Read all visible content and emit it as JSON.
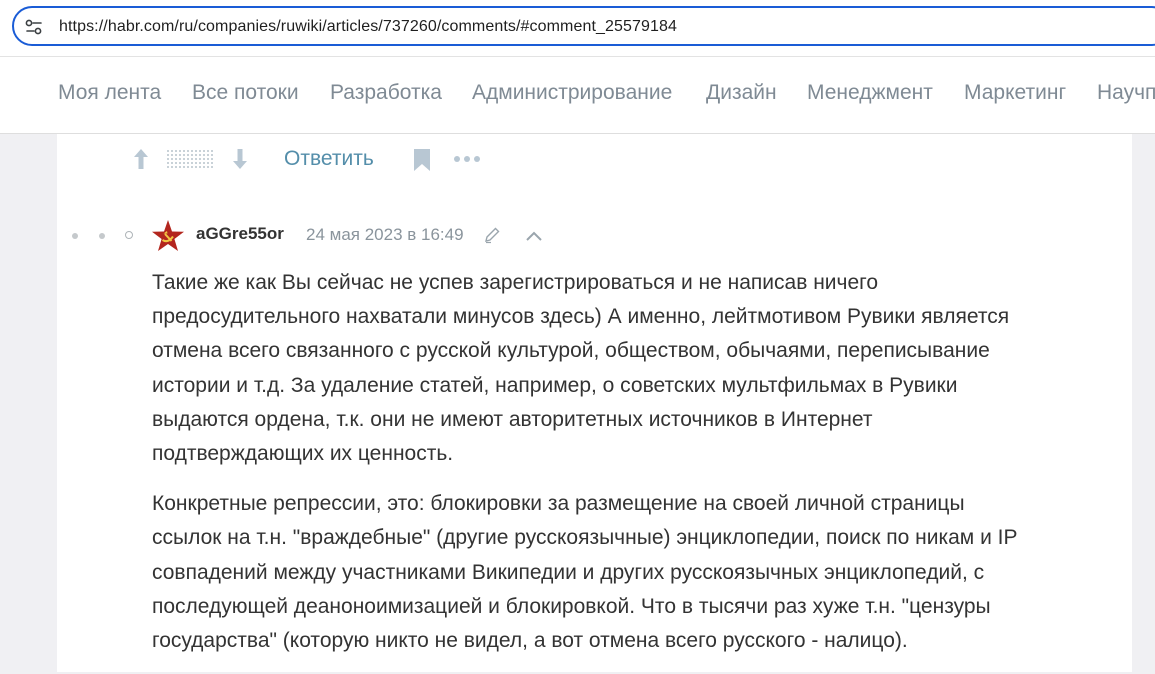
{
  "browser": {
    "url": "https://habr.com/ru/companies/ruwiki/articles/737260/comments/#comment_25579184"
  },
  "nav": {
    "items": [
      "Моя лента",
      "Все потоки",
      "Разработка",
      "Администрирование",
      "Дизайн",
      "Менеджмент",
      "Маркетинг",
      "Научп"
    ]
  },
  "actions": {
    "reply_label": "Ответить"
  },
  "comment": {
    "author": "aGGre55or",
    "date": "24 мая 2023 в 16:49",
    "paragraphs": [
      [
        "Такие же как Вы сейчас не успев зарегистрироваться и не написав ничего",
        "предосудительного нахватали минусов здесь) А именно, лейтмотивом Рувики является",
        "отмена всего связанного с русской культурой, обществом, обычаями, переписывание",
        "истории и т.д. За удаление статей, например, о советских мультфильмах в Рувики",
        "выдаются ордена, т.к. они не имеют авторитетных источников в Интернет",
        "подтверждающих их ценность."
      ],
      [
        "Конкретные репрессии, это: блокировки за размещение на своей личной страницы",
        "ссылок на т.н. \"враждебные\" (другие русскоязычные) энциклопедии, поиск по никам и IP",
        "совпадений между участниками Википедии и других русскоязычных энциклопедий, с",
        "последующей деаноноимизацией и блокировкой. Что в тысячи раз хуже т.н. \"цензуры",
        "государства\" (которую никто не видел, а вот отмена всего русского - налицо)."
      ]
    ]
  },
  "colors": {
    "accent_link": "#548eaa",
    "url_border": "#1a5cd6",
    "nav_text": "#7f8a94",
    "meta_text": "#8a949c",
    "avatar_red": "#b3261e"
  },
  "icons": [
    "site-settings-icon",
    "arrow-up-icon",
    "arrow-down-icon",
    "bookmark-icon",
    "more-icon",
    "edit-icon",
    "chevron-up-icon",
    "star-avatar"
  ]
}
